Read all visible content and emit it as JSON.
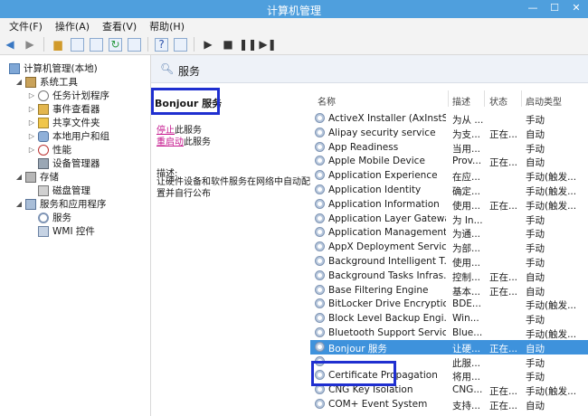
{
  "window": {
    "title": "计算机管理"
  },
  "menu": [
    "文件(F)",
    "操作(A)",
    "查看(V)",
    "帮助(H)"
  ],
  "tree": {
    "root": "计算机管理(本地)",
    "system_tools": "系统工具",
    "task_scheduler": "任务计划程序",
    "event_viewer": "事件查看器",
    "shared_folders": "共享文件夹",
    "local_users": "本地用户和组",
    "performance": "性能",
    "device_manager": "设备管理器",
    "storage": "存储",
    "disk_management": "磁盘管理",
    "services_apps": "服务和应用程序",
    "services": "服务",
    "wmi": "WMI 控件"
  },
  "panel": {
    "header": "服务",
    "service_name": "Bonjour 服务",
    "stop_link": "停止",
    "stop_suffix": "此服务",
    "restart_link": "重启动",
    "restart_suffix": "此服务",
    "desc_label": "描述:",
    "desc_text": "让硬件设备和软件服务在网络中自动配置并自行公布"
  },
  "columns": {
    "name": "名称",
    "desc": "描述",
    "status": "状态",
    "startup": "启动类型"
  },
  "services": [
    {
      "name": "ActiveX Installer (AxInstSV)",
      "desc": "为从 ...",
      "status": "",
      "startup": "手动"
    },
    {
      "name": "Alipay security service",
      "desc": "为支...",
      "status": "正在...",
      "startup": "自动"
    },
    {
      "name": "App Readiness",
      "desc": "当用...",
      "status": "",
      "startup": "手动"
    },
    {
      "name": "Apple Mobile Device",
      "desc": "Prov...",
      "status": "正在...",
      "startup": "自动"
    },
    {
      "name": "Application Experience",
      "desc": "在应...",
      "status": "",
      "startup": "手动(触发..."
    },
    {
      "name": "Application Identity",
      "desc": "确定...",
      "status": "",
      "startup": "手动(触发..."
    },
    {
      "name": "Application Information",
      "desc": "使用...",
      "status": "正在...",
      "startup": "手动(触发..."
    },
    {
      "name": "Application Layer Gatewa...",
      "desc": "为 In...",
      "status": "",
      "startup": "手动"
    },
    {
      "name": "Application Management",
      "desc": "为通...",
      "status": "",
      "startup": "手动"
    },
    {
      "name": "AppX Deployment Servic...",
      "desc": "为部...",
      "status": "",
      "startup": "手动"
    },
    {
      "name": "Background Intelligent T...",
      "desc": "使用...",
      "status": "",
      "startup": "手动"
    },
    {
      "name": "Background Tasks Infras...",
      "desc": "控制...",
      "status": "正在...",
      "startup": "自动"
    },
    {
      "name": "Base Filtering Engine",
      "desc": "基本...",
      "status": "正在...",
      "startup": "自动"
    },
    {
      "name": "BitLocker Drive Encryptio...",
      "desc": "BDE...",
      "status": "",
      "startup": "手动(触发..."
    },
    {
      "name": "Block Level Backup Engi...",
      "desc": "Win...",
      "status": "",
      "startup": "手动"
    },
    {
      "name": "Bluetooth Support Service",
      "desc": "Blue...",
      "status": "",
      "startup": "手动(触发..."
    },
    {
      "name": "Bonjour 服务",
      "desc": "让硬...",
      "status": "正在...",
      "startup": "自动",
      "selected": true
    },
    {
      "name": "",
      "desc": "此服...",
      "status": "",
      "startup": "手动"
    },
    {
      "name": "Certificate Propagation",
      "desc": "将用...",
      "status": "",
      "startup": "手动"
    },
    {
      "name": "CNG Key Isolation",
      "desc": "CNG...",
      "status": "正在...",
      "startup": "手动(触发..."
    },
    {
      "name": "COM+ Event System",
      "desc": "支持...",
      "status": "正在...",
      "startup": "自动"
    }
  ],
  "colors": {
    "titlebar": "#4f9fdd",
    "selection": "#3e92dc",
    "highlight_box": "#1f2fd0",
    "link": "#c5168d"
  }
}
